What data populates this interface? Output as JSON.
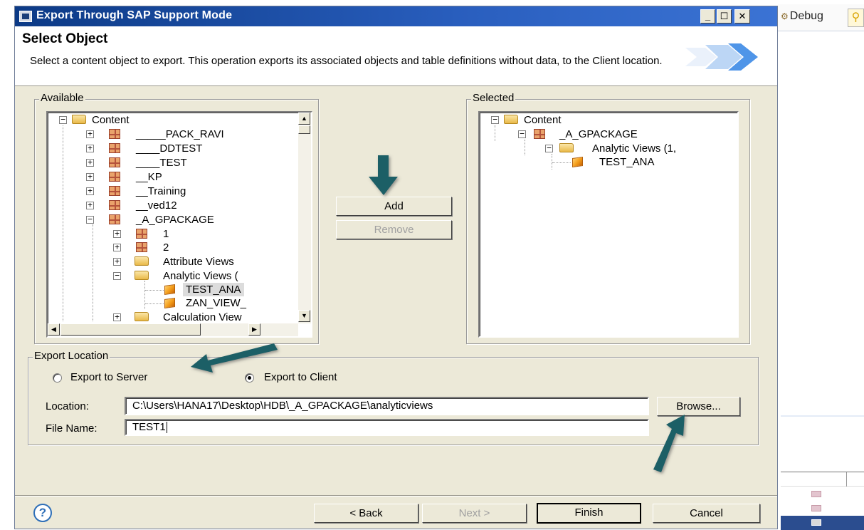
{
  "background_app": {
    "debug_tab_label": "Debug"
  },
  "dialog": {
    "title": "Export Through SAP Support Mode",
    "header": {
      "title": "Select Object",
      "description": "Select a content object to export. This operation exports its associated objects and table definitions without data, to the Client location."
    },
    "available": {
      "label": "Available",
      "items": {
        "root": "Content",
        "pack_ravi": "_____PACK_RAVI",
        "ddtest": "____DDTEST",
        "test": "____TEST",
        "kp": "__KP",
        "training": "__Training",
        "ved12": "__ved12",
        "a_gpackage": "_A_GPACKAGE",
        "sub1": "1",
        "sub2": "2",
        "attribute_views": "Attribute Views",
        "analytic_views": "Analytic Views (",
        "test_ana": "TEST_ANA",
        "zan_view": "ZAN_VIEW_",
        "calculation_views": "Calculation View"
      }
    },
    "selected": {
      "label": "Selected",
      "items": {
        "root": "Content",
        "a_gpackage": "_A_GPACKAGE",
        "analytic_views": "Analytic Views (1,",
        "test_ana": "TEST_ANA"
      }
    },
    "buttons": {
      "add": "Add",
      "remove": "Remove",
      "browse": "Browse...",
      "back": "< Back",
      "next": "Next >",
      "finish": "Finish",
      "cancel": "Cancel"
    },
    "export_location": {
      "label": "Export Location",
      "option_server": "Export to Server",
      "option_client": "Export to Client",
      "selected_option": "Export to Client",
      "location_label": "Location:",
      "location_value": "C:\\Users\\HANA17\\Desktop\\HDB\\_A_GPACKAGE\\analyticviews",
      "file_name_label": "File Name:",
      "file_name_value": "TEST1"
    },
    "help_icon": "question-mark-icon"
  },
  "colors": {
    "titlebar": "#0c3a86",
    "dialog_bg": "#ece9d8",
    "annotation_arrow": "#1f5e66"
  }
}
